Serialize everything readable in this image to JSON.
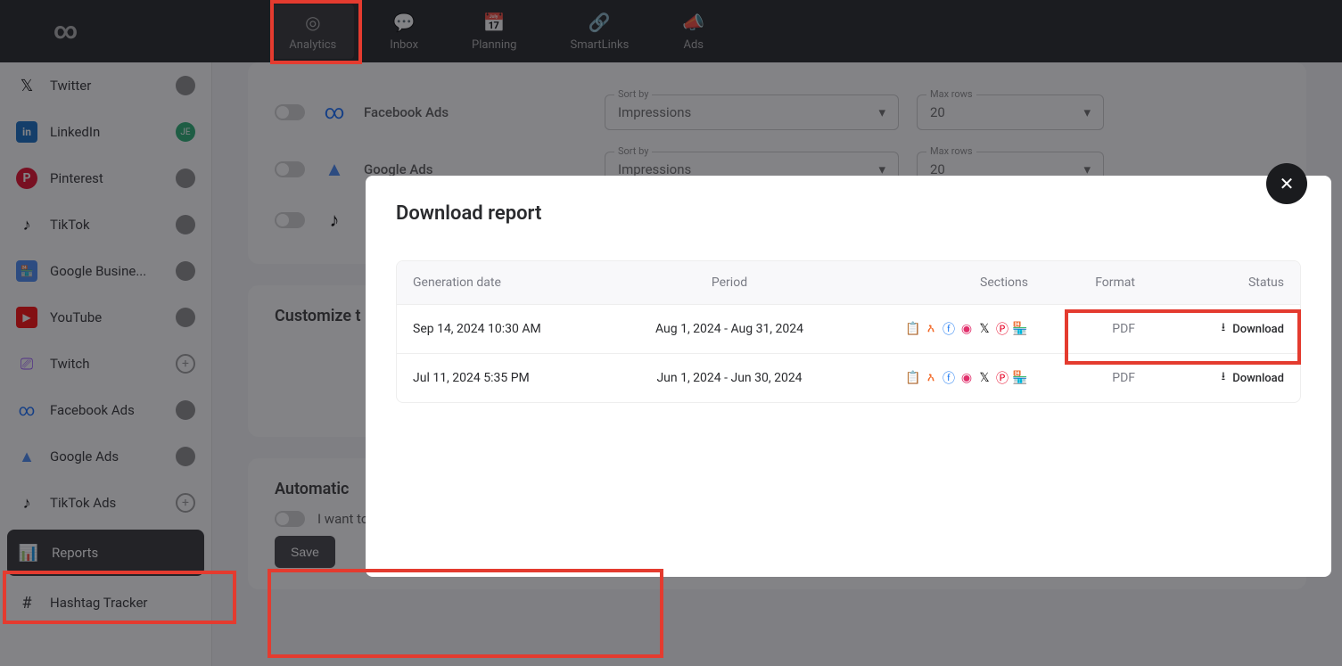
{
  "nav": {
    "items": [
      {
        "label": "Analytics",
        "icon": "◎"
      },
      {
        "label": "Inbox",
        "icon": "💬"
      },
      {
        "label": "Planning",
        "icon": "📅"
      },
      {
        "label": "SmartLinks",
        "icon": "🔗"
      },
      {
        "label": "Ads",
        "icon": "📣"
      }
    ]
  },
  "sidebar": {
    "items": [
      {
        "label": "Twitter",
        "icon": "𝕏",
        "avatar": "photo"
      },
      {
        "label": "LinkedIn",
        "icon": "in",
        "avatar": "JE",
        "avatarClass": "avatar-green"
      },
      {
        "label": "Pinterest",
        "icon": "P",
        "avatar": "photo"
      },
      {
        "label": "TikTok",
        "icon": "♪",
        "avatar": "photo"
      },
      {
        "label": "Google Busine...",
        "icon": "▭",
        "avatar": "photo"
      },
      {
        "label": "YouTube",
        "icon": "▶",
        "avatar": "photo"
      },
      {
        "label": "Twitch",
        "icon": "⎚",
        "add": true
      },
      {
        "label": "Facebook Ads",
        "icon": "∞",
        "avatar": "photo"
      },
      {
        "label": "Google Ads",
        "icon": "▲",
        "avatar": "photo"
      },
      {
        "label": "TikTok Ads",
        "icon": "♪",
        "add": true
      },
      {
        "label": "Reports",
        "icon": "📊",
        "active": true
      },
      {
        "label": "Hashtag Tracker",
        "icon": "#"
      }
    ]
  },
  "main": {
    "rows": [
      {
        "label": "Facebook Ads",
        "sortby": "Impressions",
        "maxrows": "20"
      },
      {
        "label": "Google Ads",
        "sortby": "Impressions",
        "maxrows": "20"
      }
    ],
    "sortLabel": "Sort by",
    "maxLabel": "Max rows",
    "customizeTitle": "Customize t",
    "automaticTitle": "Automatic",
    "emailOptIn": "I want to receive the report by email every month",
    "saveLabel": "Save"
  },
  "modal": {
    "title": "Download report",
    "headers": {
      "gen": "Generation date",
      "period": "Period",
      "sections": "Sections",
      "format": "Format",
      "status": "Status"
    },
    "rows": [
      {
        "gen": "Sep 14, 2024 10:30 AM",
        "period": "Aug 1, 2024 - Aug 31, 2024",
        "format": "PDF",
        "action": "Download"
      },
      {
        "gen": "Jul 11, 2024 5:35 PM",
        "period": "Jun 1, 2024 - Jun 30, 2024",
        "format": "PDF",
        "action": "Download"
      }
    ]
  }
}
